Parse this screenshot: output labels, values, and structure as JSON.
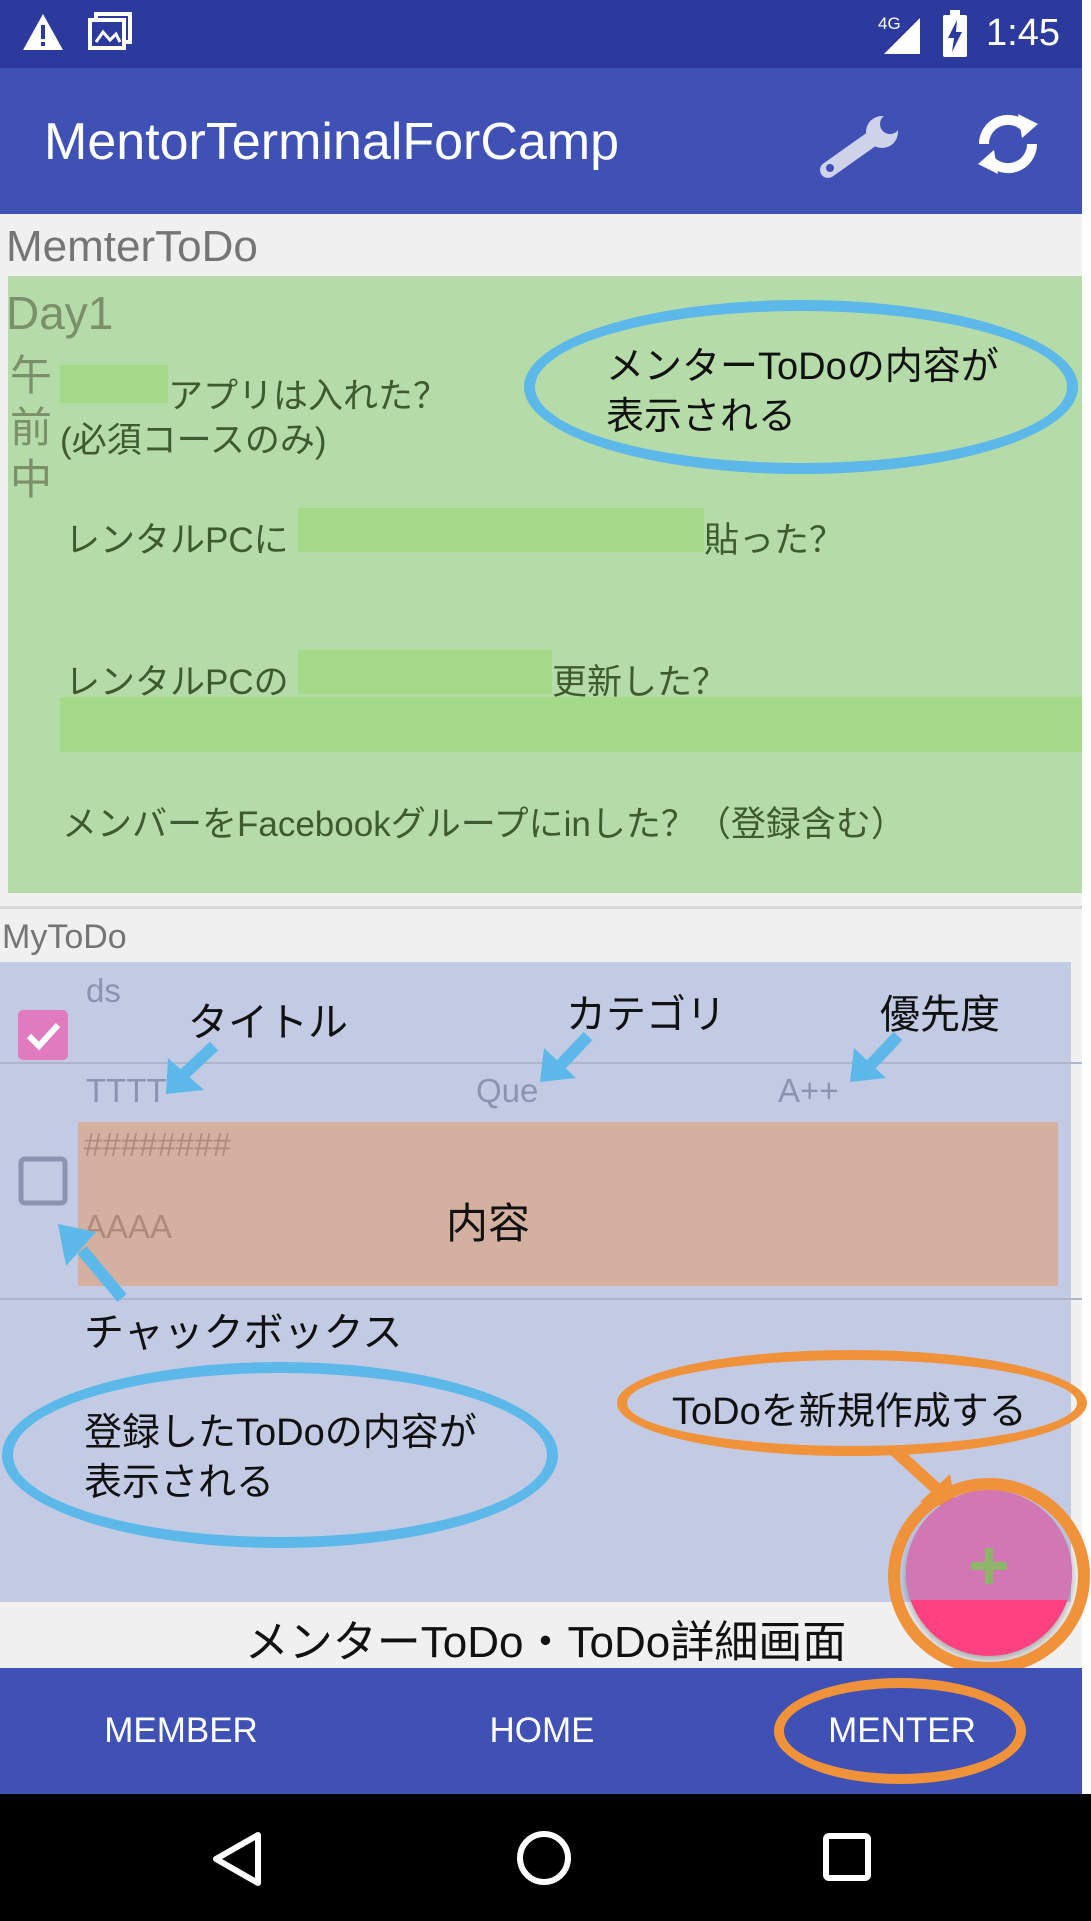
{
  "status_bar": {
    "network": "4G",
    "time": "1:45",
    "icons": [
      "warning-icon",
      "gallery-notification-icon",
      "signal-icon",
      "battery-charging-icon"
    ]
  },
  "app_bar": {
    "title": "MentorTerminalForCamp",
    "actions": [
      "wrench-icon",
      "sync-icon"
    ]
  },
  "mentor_section": {
    "header": "MemterToDo",
    "day": "Day1",
    "time_label": [
      "午",
      "前",
      "中"
    ],
    "items": [
      {
        "text": "アプリは入れた？"
      },
      {
        "text": "(必須コースのみ)"
      },
      {
        "prefix": "レンタルPCに",
        "suffix": "貼った？"
      },
      {
        "prefix": "レンタルPCの",
        "suffix": "更新した？"
      },
      {
        "text": "メンバーをFacebookグループにinした？（登録含む）"
      }
    ]
  },
  "my_section": {
    "header": "MyToDo",
    "todos": [
      {
        "title": "ds",
        "checked": true
      },
      {
        "title": "TTTT",
        "category": "Que",
        "priority": "A++",
        "content_line1": "########",
        "content_line2": "AAAA",
        "checked": false
      }
    ],
    "fab_icon": "plus-icon"
  },
  "annotations": {
    "mentor_callout": [
      "メンターToDoの内容が",
      "表示される"
    ],
    "title": "タイトル",
    "category": "カテゴリ",
    "priority": "優先度",
    "content": "内容",
    "checkbox": "チャックボックス",
    "my_callout": [
      "登録したToDoの内容が",
      "表示される"
    ],
    "new_todo": "ToDoを新規作成する",
    "screen_caption": "メンターToDo・ToDo詳細画面"
  },
  "bottom_nav": {
    "tabs": [
      "MEMBER",
      "HOME",
      "MENTER"
    ],
    "selected": "MENTER"
  },
  "system_nav": [
    "back-icon",
    "home-icon",
    "recents-icon"
  ],
  "colors": {
    "status_bar": "#2b3a9c",
    "app_bar": "#3f51b5",
    "mentor_area": "#b5dba8",
    "mytodo_area": "#c3cbe4",
    "content_highlight": "#d4b0a0",
    "fab": "#ff4081",
    "callout_blue": "#5bb8e8",
    "callout_orange": "#f0923a",
    "checkbox_checked": "#e07bbf"
  }
}
